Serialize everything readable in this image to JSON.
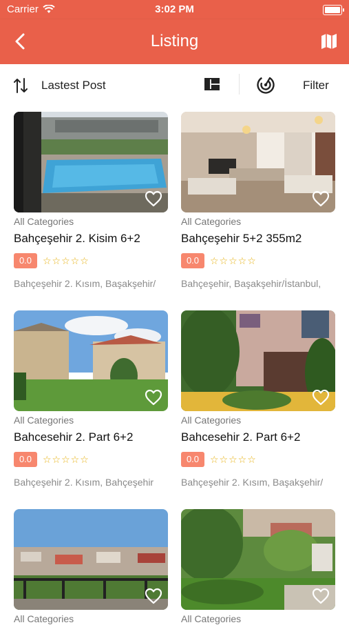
{
  "status_bar": {
    "carrier": "Carrier",
    "time": "3:02 PM"
  },
  "nav": {
    "title": "Listing",
    "back_icon": "chevron-left-icon",
    "map_icon": "map-icon"
  },
  "toolbar": {
    "sort_label": "Lastest Post",
    "filter_label": "Filter"
  },
  "colors": {
    "accent": "#e9604a",
    "badge": "#f7876e",
    "stars": "#e6b00f"
  },
  "listings": [
    {
      "category": "All Categories",
      "title": "Bahçeşehir 2. Kisim 6+2",
      "rating": "0.0",
      "stars": "☆☆☆☆☆",
      "address": "Bahçeşehir 2. Kısım, Başakşehir/"
    },
    {
      "category": "All Categories",
      "title": "Bahçeşehir 5+2 355m2",
      "rating": "0.0",
      "stars": "☆☆☆☆☆",
      "address": "Bahçeşehir, Başakşehir/İstanbul,"
    },
    {
      "category": "All Categories",
      "title": "Bahcesehir 2. Part 6+2",
      "rating": "0.0",
      "stars": "☆☆☆☆☆",
      "address": "Bahçeşehir 2. Kısım, Bahçeşehir"
    },
    {
      "category": "All Categories",
      "title": "Bahcesehir 2. Part 6+2",
      "rating": "0.0",
      "stars": "☆☆☆☆☆",
      "address": "Bahçeşehir 2. Kısım, Başakşehir/"
    },
    {
      "category": "All Categories"
    },
    {
      "category": "All Categories"
    }
  ]
}
